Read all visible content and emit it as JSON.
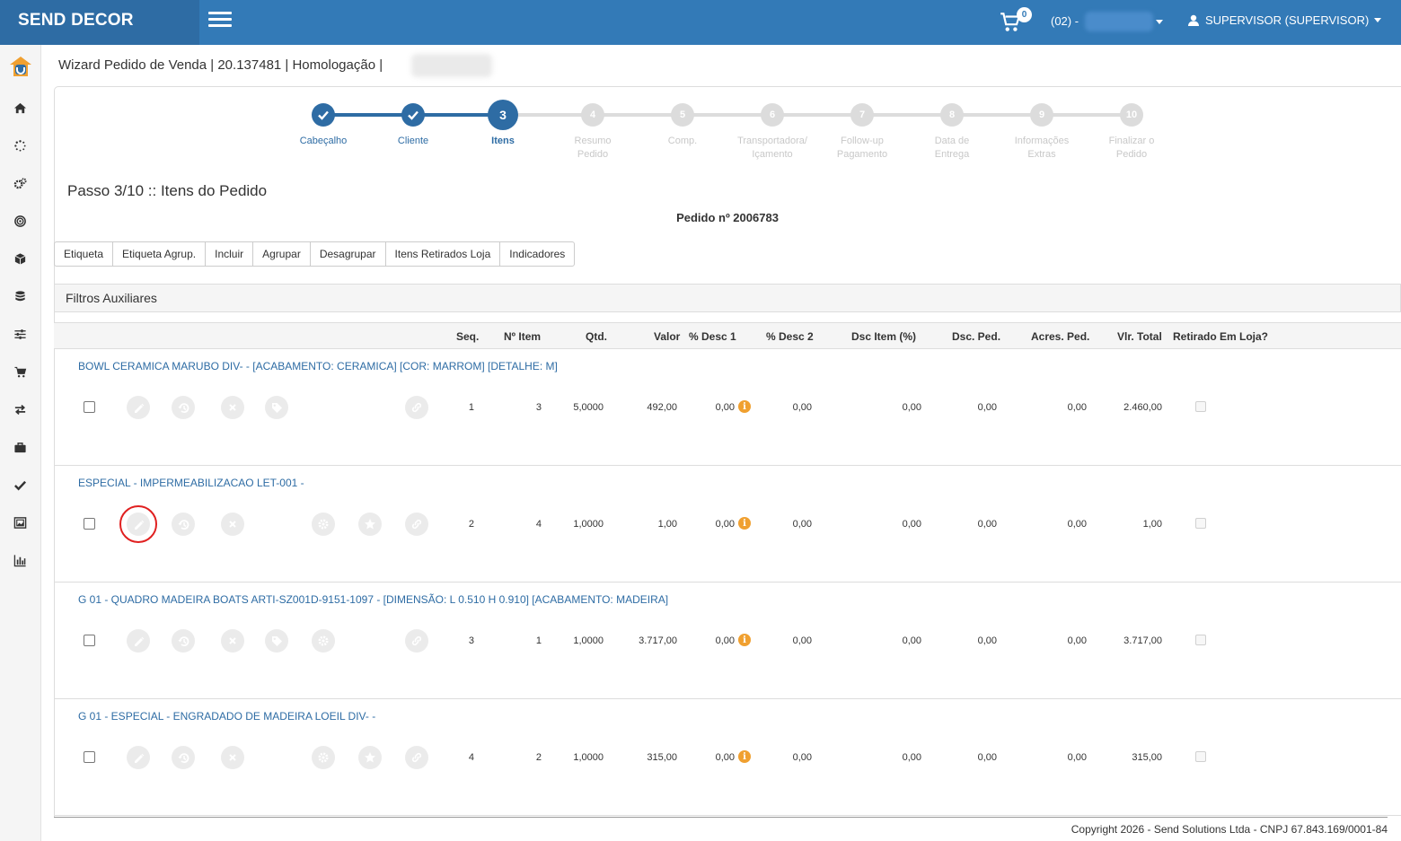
{
  "app": {
    "brand": "SEND DECOR",
    "cart_count": "0",
    "store_label": "(02) -",
    "user_label": "SUPERVISOR (SUPERVISOR)"
  },
  "sidebar_icons": [
    "home-icon",
    "spinner-icon",
    "cogs-icon",
    "bullseye-icon",
    "cube-icon",
    "database-icon",
    "sliders-icon",
    "shopping-cart-icon",
    "exchange-icon",
    "briefcase-icon",
    "check-icon",
    "image-icon",
    "bar-chart-icon"
  ],
  "page_header": "Wizard Pedido de Venda | 20.137481 | Homologação |",
  "wizard": {
    "steps": [
      {
        "num": "1",
        "label": "Cabeçalho",
        "state": "done"
      },
      {
        "num": "2",
        "label": "Cliente",
        "state": "done"
      },
      {
        "num": "3",
        "label": "Itens",
        "state": "current"
      },
      {
        "num": "4",
        "label": "Resumo\nPedido",
        "state": "todo"
      },
      {
        "num": "5",
        "label": "Comp.",
        "state": "todo"
      },
      {
        "num": "6",
        "label": "Transportadora/\nIçamento",
        "state": "todo"
      },
      {
        "num": "7",
        "label": "Follow-up\nPagamento",
        "state": "todo"
      },
      {
        "num": "8",
        "label": "Data de\nEntrega",
        "state": "todo"
      },
      {
        "num": "9",
        "label": "Informações\nExtras",
        "state": "todo"
      },
      {
        "num": "10",
        "label": "Finalizar o\nPedido",
        "state": "todo"
      }
    ]
  },
  "step_title": "Passo 3/10 :: Itens do Pedido",
  "order_number": "Pedido nº 2006783",
  "buttons": [
    "Etiqueta",
    "Etiqueta Agrup.",
    "Incluir",
    "Agrupar",
    "Desagrupar",
    "Itens Retirados Loja",
    "Indicadores"
  ],
  "filters_label": "Filtros Auxiliares",
  "table": {
    "headers": {
      "seq": "Seq.",
      "item": "Nº Item",
      "qtd": "Qtd.",
      "valor": "Valor",
      "desc1": "% Desc 1",
      "desc2": "% Desc 2",
      "dsc_item": "Dsc Item (%)",
      "dsc_ped": "Dsc. Ped.",
      "acres_ped": "Acres. Ped.",
      "vlr_total": "Vlr. Total",
      "retirado": "Retirado Em Loja?"
    },
    "rows": [
      {
        "title": "BOWL CERAMICA MARUBO DIV- - [ACABAMENTO: CERAMICA] [COR: MARROM] [DETALHE: M]",
        "seq": "1",
        "item": "3",
        "qtd": "5,0000",
        "valor": "492,00",
        "desc1": "0,00",
        "desc2": "0,00",
        "dsc_item": "0,00",
        "dsc_ped": "0,00",
        "acres_ped": "0,00",
        "vlr_total": "2.460,00"
      },
      {
        "title": "ESPECIAL - IMPERMEABILIZACAO LET-001 -",
        "seq": "2",
        "item": "4",
        "qtd": "1,0000",
        "valor": "1,00",
        "desc1": "0,00",
        "desc2": "0,00",
        "dsc_item": "0,00",
        "dsc_ped": "0,00",
        "acres_ped": "0,00",
        "vlr_total": "1,00"
      },
      {
        "title": "G 01 - QUADRO MADEIRA BOATS ARTI-SZ001D-9151-1097 - [DIMENSÃO: L 0.510 H 0.910] [ACABAMENTO: MADEIRA]",
        "seq": "3",
        "item": "1",
        "qtd": "1,0000",
        "valor": "3.717,00",
        "desc1": "0,00",
        "desc2": "0,00",
        "dsc_item": "0,00",
        "dsc_ped": "0,00",
        "acres_ped": "0,00",
        "vlr_total": "3.717,00"
      },
      {
        "title": "G 01 - ESPECIAL - ENGRADADO DE MADEIRA LOEIL DIV- -",
        "seq": "4",
        "item": "2",
        "qtd": "1,0000",
        "valor": "315,00",
        "desc1": "0,00",
        "desc2": "0,00",
        "dsc_item": "0,00",
        "dsc_ped": "0,00",
        "acres_ped": "0,00",
        "vlr_total": "315,00"
      }
    ]
  },
  "footer": "Copyright 2026 - Send Solutions Ltda - CNPJ 67.843.169/0001-84"
}
